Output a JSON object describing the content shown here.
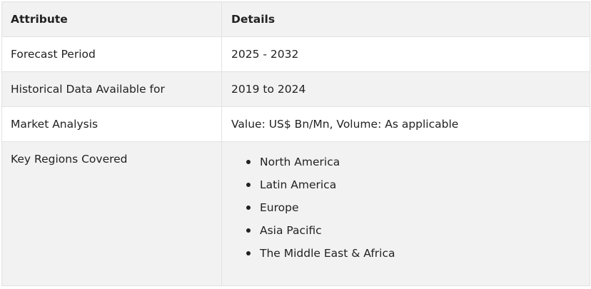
{
  "table": {
    "headers": [
      "Attribute",
      "Details"
    ],
    "rows": [
      {
        "attribute": "Forecast Period",
        "details": "2025 - 2032"
      },
      {
        "attribute": "Historical Data Available for",
        "details": "2019 to 2024"
      },
      {
        "attribute": "Market Analysis",
        "details": "Value: US$ Bn/Mn, Volume: As applicable"
      },
      {
        "attribute": "Key Regions Covered",
        "details_list": [
          "North America",
          "Latin America",
          "Europe",
          "Asia Pacific",
          "The Middle East & Africa"
        ]
      }
    ]
  },
  "colors": {
    "header_bg": "#f2f2f2",
    "alt_row_bg": "#f2f2f2",
    "border": "#e2e2e2",
    "text": "#222222"
  }
}
